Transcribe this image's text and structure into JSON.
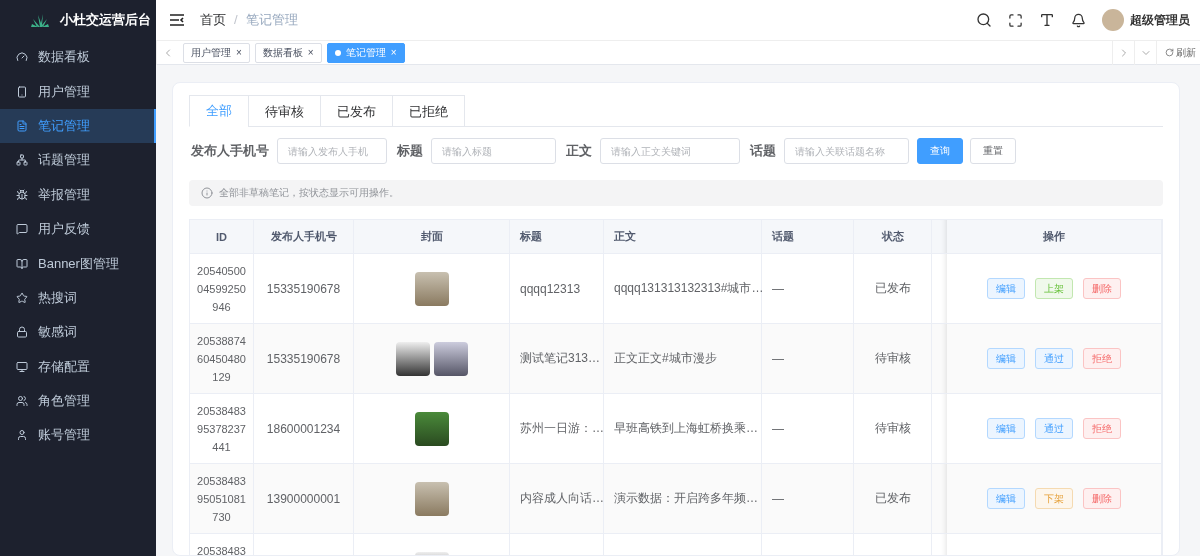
{
  "brand": {
    "title": "小杜交运营后台"
  },
  "sidebar": {
    "items": [
      {
        "label": "数据看板",
        "selected": false
      },
      {
        "label": "用户管理",
        "selected": false
      },
      {
        "label": "笔记管理",
        "selected": true
      },
      {
        "label": "话题管理",
        "selected": false
      },
      {
        "label": "举报管理",
        "selected": false
      },
      {
        "label": "用户反馈",
        "selected": false
      },
      {
        "label": "Banner图管理",
        "selected": false
      },
      {
        "label": "热搜词",
        "selected": false
      },
      {
        "label": "敏感词",
        "selected": false
      },
      {
        "label": "存储配置",
        "selected": false
      },
      {
        "label": "角色管理",
        "selected": false
      },
      {
        "label": "账号管理",
        "selected": false
      }
    ]
  },
  "breadcrumb": [
    "首页",
    "笔记管理"
  ],
  "breadcrumb_separator": "/",
  "user": {
    "name": "超级管理员"
  },
  "tags": [
    {
      "label": "用户管理",
      "close": "×",
      "selected": false
    },
    {
      "label": "数据看板",
      "close": "×",
      "selected": false
    },
    {
      "label": "笔记管理",
      "close": "×",
      "selected": true
    }
  ],
  "refresh": "刷新",
  "tabs": [
    {
      "label": "全部",
      "selected": true
    },
    {
      "label": "待审核",
      "selected": false
    },
    {
      "label": "已发布",
      "selected": false
    },
    {
      "label": "已拒绝",
      "selected": false
    }
  ],
  "filters": [
    {
      "label": "发布人手机号",
      "placeholder": "请输入发布人手机"
    },
    {
      "label": "标题",
      "placeholder": "请输入标题"
    },
    {
      "label": "正文",
      "placeholder": "请输入正文关键词"
    },
    {
      "label": "话题",
      "placeholder": "请输入关联话题名称"
    }
  ],
  "search_button": "查询",
  "reset_button": "重置",
  "info": "全部非草稿笔记，按状态显示可用操作。",
  "table": {
    "columns": [
      "ID",
      "发布人手机号",
      "封面",
      "标题",
      "正文",
      "话题",
      "状态",
      "操作"
    ],
    "rows": [
      {
        "id": "2054050004599250946",
        "phone": "15335190678",
        "covers": [
          {
            "kind": "photo"
          }
        ],
        "title": "qqqq12313",
        "body": "qqqq131313132313#城市…",
        "topic": "—",
        "status": "已发布",
        "actions": [
          {
            "label": "编辑",
            "kind": "primary"
          },
          {
            "label": "上架",
            "kind": "success"
          },
          {
            "label": "删除",
            "kind": "danger"
          }
        ]
      },
      {
        "id": "2053887460450480129",
        "phone": "15335190678",
        "covers": [
          {
            "kind": "photo"
          },
          {
            "kind": "photo"
          }
        ],
        "title": "测试笔记313…",
        "body": "正文正文#城市漫步",
        "topic": "—",
        "status": "待审核",
        "actions": [
          {
            "label": "编辑",
            "kind": "primary"
          },
          {
            "label": "通过",
            "kind": "primary"
          },
          {
            "label": "拒绝",
            "kind": "danger"
          }
        ]
      },
      {
        "id": "2053848395378237441",
        "phone": "18600001234",
        "covers": [
          {
            "kind": "photo"
          }
        ],
        "title": "苏州一日游：…",
        "body": "早班高铁到上海虹桥换乘…",
        "topic": "—",
        "status": "待审核",
        "actions": [
          {
            "label": "编辑",
            "kind": "primary"
          },
          {
            "label": "通过",
            "kind": "primary"
          },
          {
            "label": "拒绝",
            "kind": "danger"
          }
        ]
      },
      {
        "id": "2053848395051081730",
        "phone": "13900000001",
        "covers": [
          {
            "kind": "photo"
          }
        ],
        "title": "内容成人向话…",
        "body": "演示数据：开启跨多年频…",
        "topic": "—",
        "status": "已发布",
        "actions": [
          {
            "label": "编辑",
            "kind": "primary"
          },
          {
            "label": "下架",
            "kind": "warning"
          },
          {
            "label": "删除",
            "kind": "danger"
          }
        ]
      },
      {
        "id": "20538483",
        "covers": [
          {
            "kind": "photo"
          }
        ]
      }
    ]
  }
}
